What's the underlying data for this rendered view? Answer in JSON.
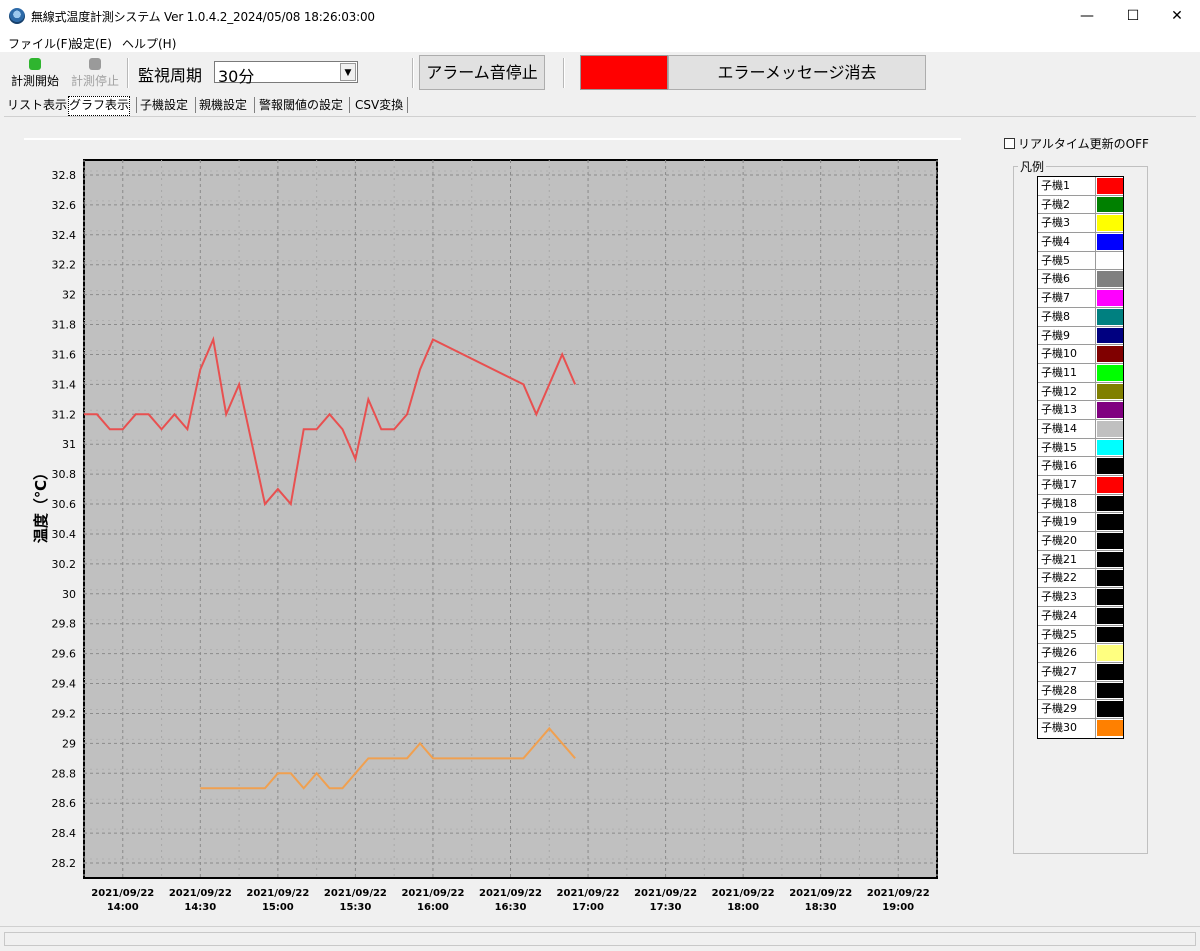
{
  "window": {
    "title": "無線式温度計測システム Ver 1.0.4.2_2024/05/08 18:26:03:00",
    "minimize": "—",
    "maximize": "☐",
    "close": "✕"
  },
  "menu": [
    "ファイル(F)",
    "設定(E)",
    "ヘルプ(H)"
  ],
  "toolbar": {
    "start_label": "計測開始",
    "start_color": "#2fb52f",
    "stop_label": "計測停止",
    "stop_color": "#9a9a9a",
    "period_label": "監視周期",
    "period_value": "30分",
    "alarm_stop_label": "アラーム音停止",
    "error_indicator_color": "#ff0000",
    "error_clear_label": "エラーメッセージ消去"
  },
  "tabs": [
    {
      "label": "リスト表示",
      "active": false
    },
    {
      "label": "グラフ表示",
      "active": true
    },
    {
      "label": "子機設定",
      "active": false
    },
    {
      "label": "親機設定",
      "active": false
    },
    {
      "label": "警報閾値の設定",
      "active": false
    },
    {
      "label": "CSV変換",
      "active": false
    }
  ],
  "realtime_off_label": "リアルタイム更新のOFF",
  "legend": {
    "title": "凡例",
    "items": [
      {
        "name": "子機1",
        "color": "#ff0000"
      },
      {
        "name": "子機2",
        "color": "#008000"
      },
      {
        "name": "子機3",
        "color": "#ffff00"
      },
      {
        "name": "子機4",
        "color": "#0000ff"
      },
      {
        "name": "子機5",
        "color": "#ffffff"
      },
      {
        "name": "子機6",
        "color": "#808080"
      },
      {
        "name": "子機7",
        "color": "#ff00ff"
      },
      {
        "name": "子機8",
        "color": "#008080"
      },
      {
        "name": "子機9",
        "color": "#000080"
      },
      {
        "name": "子機10",
        "color": "#800000"
      },
      {
        "name": "子機11",
        "color": "#00ff00"
      },
      {
        "name": "子機12",
        "color": "#808000"
      },
      {
        "name": "子機13",
        "color": "#800080"
      },
      {
        "name": "子機14",
        "color": "#c0c0c0"
      },
      {
        "name": "子機15",
        "color": "#00ffff"
      },
      {
        "name": "子機16",
        "color": "#000000"
      },
      {
        "name": "子機17",
        "color": "#ff0000"
      },
      {
        "name": "子機18",
        "color": "#000000"
      },
      {
        "name": "子機19",
        "color": "#000000"
      },
      {
        "name": "子機20",
        "color": "#000000"
      },
      {
        "name": "子機21",
        "color": "#000000"
      },
      {
        "name": "子機22",
        "color": "#000000"
      },
      {
        "name": "子機23",
        "color": "#000000"
      },
      {
        "name": "子機24",
        "color": "#000000"
      },
      {
        "name": "子機25",
        "color": "#000000"
      },
      {
        "name": "子機26",
        "color": "#ffff80"
      },
      {
        "name": "子機27",
        "color": "#000000"
      },
      {
        "name": "子機28",
        "color": "#000000"
      },
      {
        "name": "子機29",
        "color": "#000000"
      },
      {
        "name": "子機30",
        "color": "#ff8000"
      }
    ]
  },
  "chart_data": {
    "type": "line",
    "title": "",
    "ylabel": "温度（℃）",
    "xlabel": "",
    "ylim": [
      28.1,
      32.9
    ],
    "yticks": [
      28.2,
      28.4,
      28.6,
      28.8,
      29,
      29.2,
      29.4,
      29.6,
      29.8,
      30,
      30.2,
      30.4,
      30.6,
      30.8,
      31,
      31.2,
      31.4,
      31.6,
      31.8,
      32,
      32.2,
      32.4,
      32.6,
      32.8
    ],
    "xlim": [
      "2021/09/22 13:45",
      "2021/09/22 19:15"
    ],
    "xticks": [
      {
        "date": "2021/09/22",
        "time": "14:00"
      },
      {
        "date": "2021/09/22",
        "time": "14:30"
      },
      {
        "date": "2021/09/22",
        "time": "15:00"
      },
      {
        "date": "2021/09/22",
        "time": "15:30"
      },
      {
        "date": "2021/09/22",
        "time": "16:00"
      },
      {
        "date": "2021/09/22",
        "time": "16:30"
      },
      {
        "date": "2021/09/22",
        "time": "17:00"
      },
      {
        "date": "2021/09/22",
        "time": "17:30"
      },
      {
        "date": "2021/09/22",
        "time": "18:00"
      },
      {
        "date": "2021/09/22",
        "time": "18:30"
      },
      {
        "date": "2021/09/22",
        "time": "19:00"
      }
    ],
    "grid": true,
    "background": "#c0c0c0",
    "series": [
      {
        "color": "#e85050",
        "points": [
          [
            "2021/09/22 13:45",
            31.2
          ],
          [
            "2021/09/22 13:50",
            31.2
          ],
          [
            "2021/09/22 13:55",
            31.1
          ],
          [
            "2021/09/22 14:00",
            31.1
          ],
          [
            "2021/09/22 14:05",
            31.2
          ],
          [
            "2021/09/22 14:10",
            31.2
          ],
          [
            "2021/09/22 14:15",
            31.1
          ],
          [
            "2021/09/22 14:20",
            31.2
          ],
          [
            "2021/09/22 14:25",
            31.1
          ],
          [
            "2021/09/22 14:30",
            31.5
          ],
          [
            "2021/09/22 14:35",
            31.7
          ],
          [
            "2021/09/22 14:40",
            31.2
          ],
          [
            "2021/09/22 14:45",
            31.4
          ],
          [
            "2021/09/22 14:50",
            31.0
          ],
          [
            "2021/09/22 14:55",
            30.6
          ],
          [
            "2021/09/22 15:00",
            30.7
          ],
          [
            "2021/09/22 15:05",
            30.6
          ],
          [
            "2021/09/22 15:10",
            31.1
          ],
          [
            "2021/09/22 15:15",
            31.1
          ],
          [
            "2021/09/22 15:20",
            31.2
          ],
          [
            "2021/09/22 15:25",
            31.1
          ],
          [
            "2021/09/22 15:30",
            30.9
          ],
          [
            "2021/09/22 15:35",
            31.3
          ],
          [
            "2021/09/22 15:40",
            31.1
          ],
          [
            "2021/09/22 15:45",
            31.1
          ],
          [
            "2021/09/22 15:50",
            31.2
          ],
          [
            "2021/09/22 15:55",
            31.5
          ],
          [
            "2021/09/22 16:00",
            31.7
          ],
          [
            "2021/09/22 16:35",
            31.4
          ],
          [
            "2021/09/22 16:40",
            31.2
          ],
          [
            "2021/09/22 16:45",
            31.4
          ],
          [
            "2021/09/22 16:50",
            31.6
          ],
          [
            "2021/09/22 16:55",
            31.4
          ]
        ]
      },
      {
        "color": "#f0a050",
        "points": [
          [
            "2021/09/22 14:30",
            28.7
          ],
          [
            "2021/09/22 14:55",
            28.7
          ],
          [
            "2021/09/22 15:00",
            28.8
          ],
          [
            "2021/09/22 15:05",
            28.8
          ],
          [
            "2021/09/22 15:10",
            28.7
          ],
          [
            "2021/09/22 15:15",
            28.8
          ],
          [
            "2021/09/22 15:20",
            28.7
          ],
          [
            "2021/09/22 15:25",
            28.7
          ],
          [
            "2021/09/22 15:30",
            28.8
          ],
          [
            "2021/09/22 15:35",
            28.9
          ],
          [
            "2021/09/22 15:50",
            28.9
          ],
          [
            "2021/09/22 15:55",
            29.0
          ],
          [
            "2021/09/22 16:00",
            28.9
          ],
          [
            "2021/09/22 16:35",
            28.9
          ],
          [
            "2021/09/22 16:40",
            29.0
          ],
          [
            "2021/09/22 16:45",
            29.1
          ],
          [
            "2021/09/22 16:55",
            28.9
          ]
        ]
      }
    ]
  }
}
